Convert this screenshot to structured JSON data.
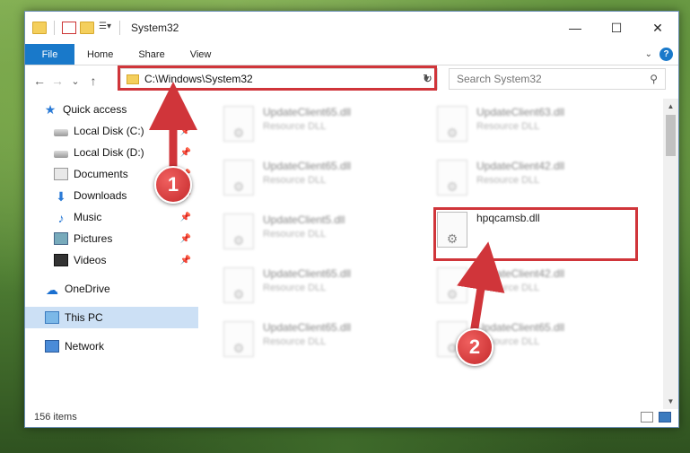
{
  "window": {
    "title": "System32",
    "controls": {
      "minimize": "—",
      "maximize": "☐",
      "close": "✕"
    }
  },
  "ribbon": {
    "file": "File",
    "tabs": [
      "Home",
      "Share",
      "View"
    ],
    "help": "?"
  },
  "nav": {
    "back": "←",
    "forward": "→",
    "recent": "⌄",
    "up": "↑",
    "address": "C:\\Windows\\System32",
    "search_placeholder": "Search System32"
  },
  "sidebar": {
    "quick_access": "Quick access",
    "items": [
      {
        "label": "Local Disk (C:)",
        "icon": "disk-icon",
        "pinned": true
      },
      {
        "label": "Local Disk (D:)",
        "icon": "disk-icon",
        "pinned": true
      },
      {
        "label": "Documents",
        "icon": "documents-icon",
        "pinned": true
      },
      {
        "label": "Downloads",
        "icon": "download-icon",
        "pinned": true
      },
      {
        "label": "Music",
        "icon": "music-icon",
        "pinned": true
      },
      {
        "label": "Pictures",
        "icon": "pictures-icon",
        "pinned": true
      },
      {
        "label": "Videos",
        "icon": "videos-icon",
        "pinned": true
      }
    ],
    "onedrive": "OneDrive",
    "this_pc": "This PC",
    "network": "Network"
  },
  "files": [
    {
      "name": "UpdateClient65.dll",
      "type": "Resource DLL"
    },
    {
      "name": "UpdateClient63.dll",
      "type": "Resource DLL"
    },
    {
      "name": "UpdateClient65.dll",
      "type": "Resource DLL"
    },
    {
      "name": "UpdateClient42.dll",
      "type": "Resource DLL"
    },
    {
      "name": "UpdateClient5.dll",
      "type": "Resource DLL"
    },
    {
      "name": "hpqcamsb.dll",
      "type": ""
    },
    {
      "name": "UpdateClient65.dll",
      "type": "Resource DLL"
    },
    {
      "name": "UpdateClient42.dll",
      "type": "Resource DLL"
    },
    {
      "name": "UpdateClient65.dll",
      "type": "Resource DLL"
    },
    {
      "name": "UpdateClient65.dll",
      "type": "Resource DLL"
    }
  ],
  "status": {
    "item_count": "156 items"
  },
  "annotations": {
    "marker1": "1",
    "marker2": "2",
    "color": "#d0353a"
  }
}
